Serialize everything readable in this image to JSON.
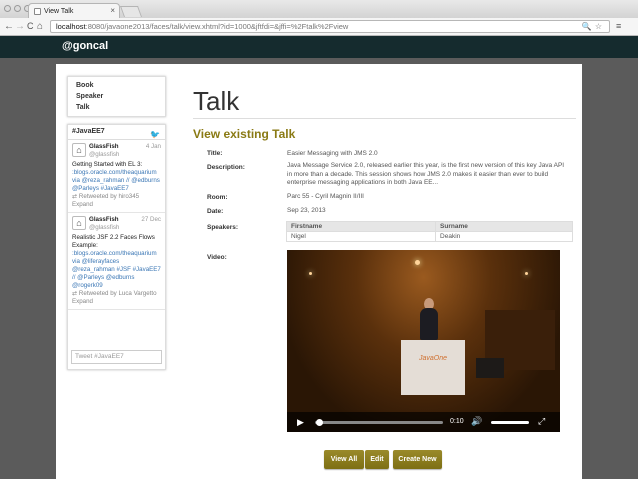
{
  "browser": {
    "tab_title": "View Talk",
    "tab_close": "×",
    "url_host": "localhost",
    "url_rest": ":8080/javaone2013/faces/talk/view.xhtml?id=1000&jftfdi=&jffi=%2Ftalk%2Fview",
    "nav_back": "←",
    "nav_forward": "→",
    "nav_reload": "C",
    "nav_home": "⌂"
  },
  "app": {
    "brand": "@goncal"
  },
  "sidebar": {
    "items": [
      {
        "label": "Book"
      },
      {
        "label": "Speaker"
      },
      {
        "label": "Talk"
      }
    ]
  },
  "twitter": {
    "header": "#JavaEE7",
    "tweets": [
      {
        "name": "GlassFish",
        "handle": "@glassfish",
        "date": "4 Jan",
        "text": "Getting Started with EL 3:",
        "links": ":blogs.oracle.com/theaquarium via @reza_rahman // @edburns @Parleys #JavaEE7",
        "retweet": "Retweeted by hiro345",
        "expand": "Expand"
      },
      {
        "name": "GlassFish",
        "handle": "@glassfish",
        "date": "27 Dec",
        "text": "Realistic JSF 2.2 Faces Flows Example:",
        "links": ":blogs.oracle.com/theaquarium via @liferayfaces @reza_rahman #JSF #JavaEE7 // @Parleys @edburns @rogerk09",
        "retweet": "Retweeted by Luca Vargetto",
        "expand": "Expand"
      }
    ],
    "compose_placeholder": "Tweet #JavaEE7"
  },
  "main": {
    "title": "Talk",
    "subtitle": "View existing Talk",
    "fields": {
      "title_label": "Title:",
      "title_value": "Easier Messaging with JMS 2.0",
      "description_label": "Description:",
      "description_value": "Java Message Service 2.0, released earlier this year, is the first new version of this key Java API in more than a decade. This session shows how JMS 2.0 makes it easier than ever to build enterprise messaging applications in both Java EE...",
      "room_label": "Room:",
      "room_value": "Parc 55 - Cyril Magnin II/III",
      "date_label": "Date:",
      "date_value": "Sep 23, 2013",
      "speakers_label": "Speakers:",
      "video_label": "Video:"
    },
    "speakers_table": {
      "headers": [
        "Firstname",
        "Surname"
      ],
      "rows": [
        [
          "Nigel",
          "Deakin"
        ]
      ]
    },
    "video": {
      "time": "0:10",
      "progress": 0.02,
      "podium_logo": "JavaOne"
    },
    "buttons": {
      "view_all": "View All",
      "edit": "Edit",
      "create_new": "Create New"
    }
  },
  "colors": {
    "header_bg": "#152b2e",
    "accent": "#8a7a14",
    "page_bg": "#5b5b5b"
  }
}
